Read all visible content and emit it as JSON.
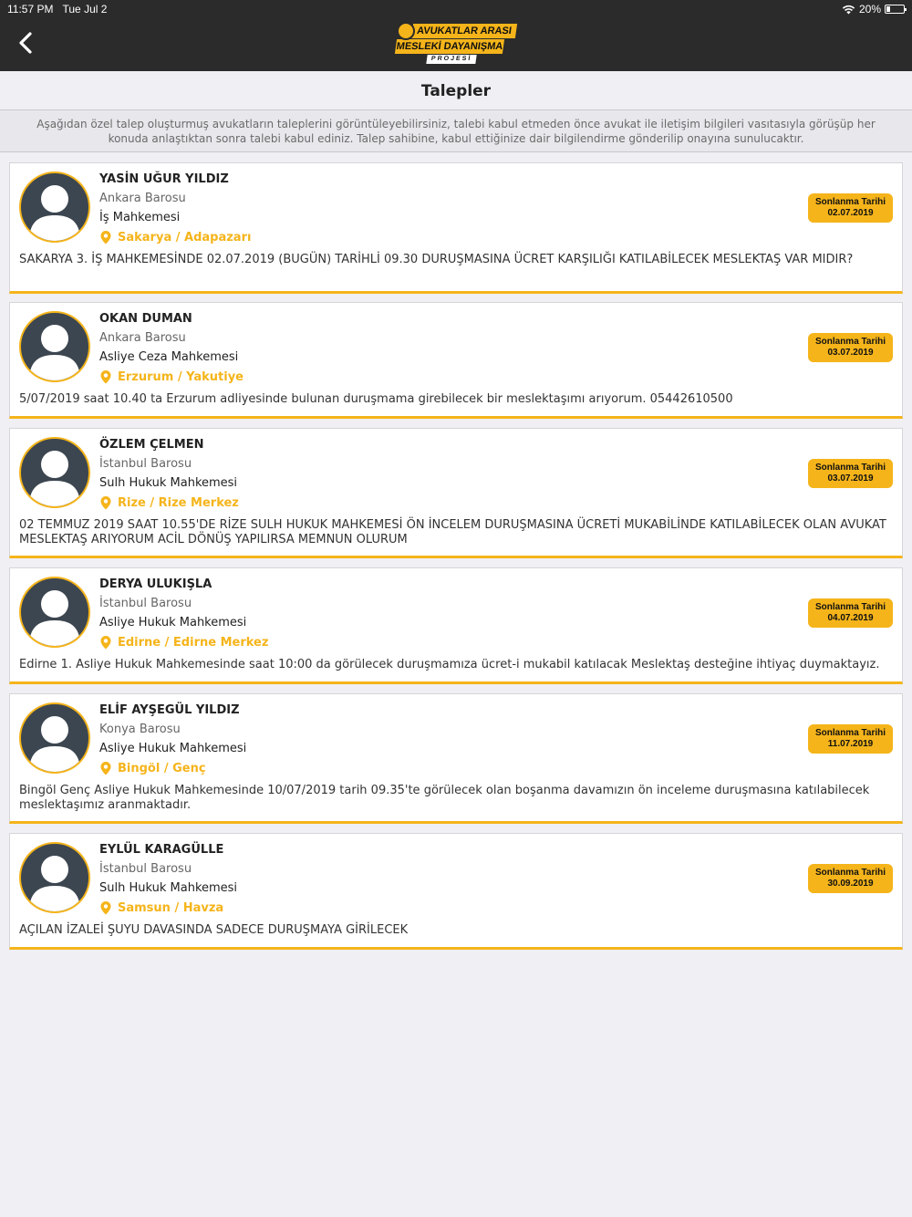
{
  "status": {
    "time": "11:57 PM",
    "date": "Tue Jul 2",
    "battery": "20%"
  },
  "logo": {
    "line1": "AVUKATLAR ARASI",
    "line2": "MESLEKİ DAYANIŞMA",
    "line3": "PROJESİ"
  },
  "page_title": "Talepler",
  "info_text": "Aşağıdan özel talep oluşturmuş avukatların taleplerini görüntüleyebilirsiniz, talebi kabul etmeden önce avukat ile iletişim bilgileri vasıtasıyla görüşüp her konuda anlaştıktan sonra talebi kabul ediniz. Talep sahibine, kabul ettiğinize dair bilgilendirme gönderilip onayına sunulucaktır.",
  "deadline_label": "Sonlanma Tarihi",
  "requests": [
    {
      "name": "YASİN UĞUR YILDIZ",
      "bar": "Ankara Barosu",
      "court": "İş Mahkemesi",
      "location": "Sakarya / Adapazarı",
      "deadline": "02.07.2019",
      "description": "SAKARYA 3. İŞ MAHKEMESİNDE 02.07.2019 (BUGÜN) TARİHLİ 09.30 DURUŞMASINA ÜCRET KARŞILIĞI KATILABİLECEK MESLEKTAŞ VAR MIDIR?"
    },
    {
      "name": "OKAN DUMAN",
      "bar": "Ankara Barosu",
      "court": "Asliye Ceza Mahkemesi",
      "location": "Erzurum / Yakutiye",
      "deadline": "03.07.2019",
      "description": "5/07/2019 saat 10.40 ta Erzurum adliyesinde bulunan duruşmama girebilecek bir meslektaşımı arıyorum. 05442610500"
    },
    {
      "name": "ÖZLEM ÇELMEN",
      "bar": "İstanbul Barosu",
      "court": "Sulh Hukuk Mahkemesi",
      "location": "Rize / Rize Merkez",
      "deadline": "03.07.2019",
      "description": "02 TEMMUZ 2019 SAAT 10.55'DE RİZE SULH HUKUK MAHKEMESİ ÖN İNCELEM DURUŞMASINA ÜCRETİ MUKABİLİNDE KATILABİLECEK OLAN AVUKAT MESLEKTAŞ ARIYORUM ACİL DÖNÜŞ YAPILIRSA MEMNUN OLURUM"
    },
    {
      "name": "DERYA ULUKIŞLA",
      "bar": "İstanbul Barosu",
      "court": "Asliye Hukuk Mahkemesi",
      "location": "Edirne / Edirne Merkez",
      "deadline": "04.07.2019",
      "description": "Edirne 1. Asliye Hukuk Mahkemesinde saat 10:00 da görülecek duruşmamıza ücret-i mukabil katılacak Meslektaş desteğine ihtiyaç duymaktayız."
    },
    {
      "name": "ELİF AYŞEGÜL YILDIZ",
      "bar": "Konya Barosu",
      "court": "Asliye Hukuk Mahkemesi",
      "location": "Bingöl / Genç",
      "deadline": "11.07.2019",
      "description": "Bingöl Genç Asliye Hukuk Mahkemesinde 10/07/2019 tarih 09.35'te görülecek olan boşanma davamızın ön inceleme duruşmasına katılabilecek meslektaşımız aranmaktadır."
    },
    {
      "name": "EYLÜL KARAGÜLLE",
      "bar": "İstanbul Barosu",
      "court": "Sulh Hukuk Mahkemesi",
      "location": "Samsun / Havza",
      "deadline": "30.09.2019",
      "description": "AÇILAN İZALEİ ŞUYU DAVASINDA SADECE DURUŞMAYA GİRİLECEK"
    }
  ]
}
